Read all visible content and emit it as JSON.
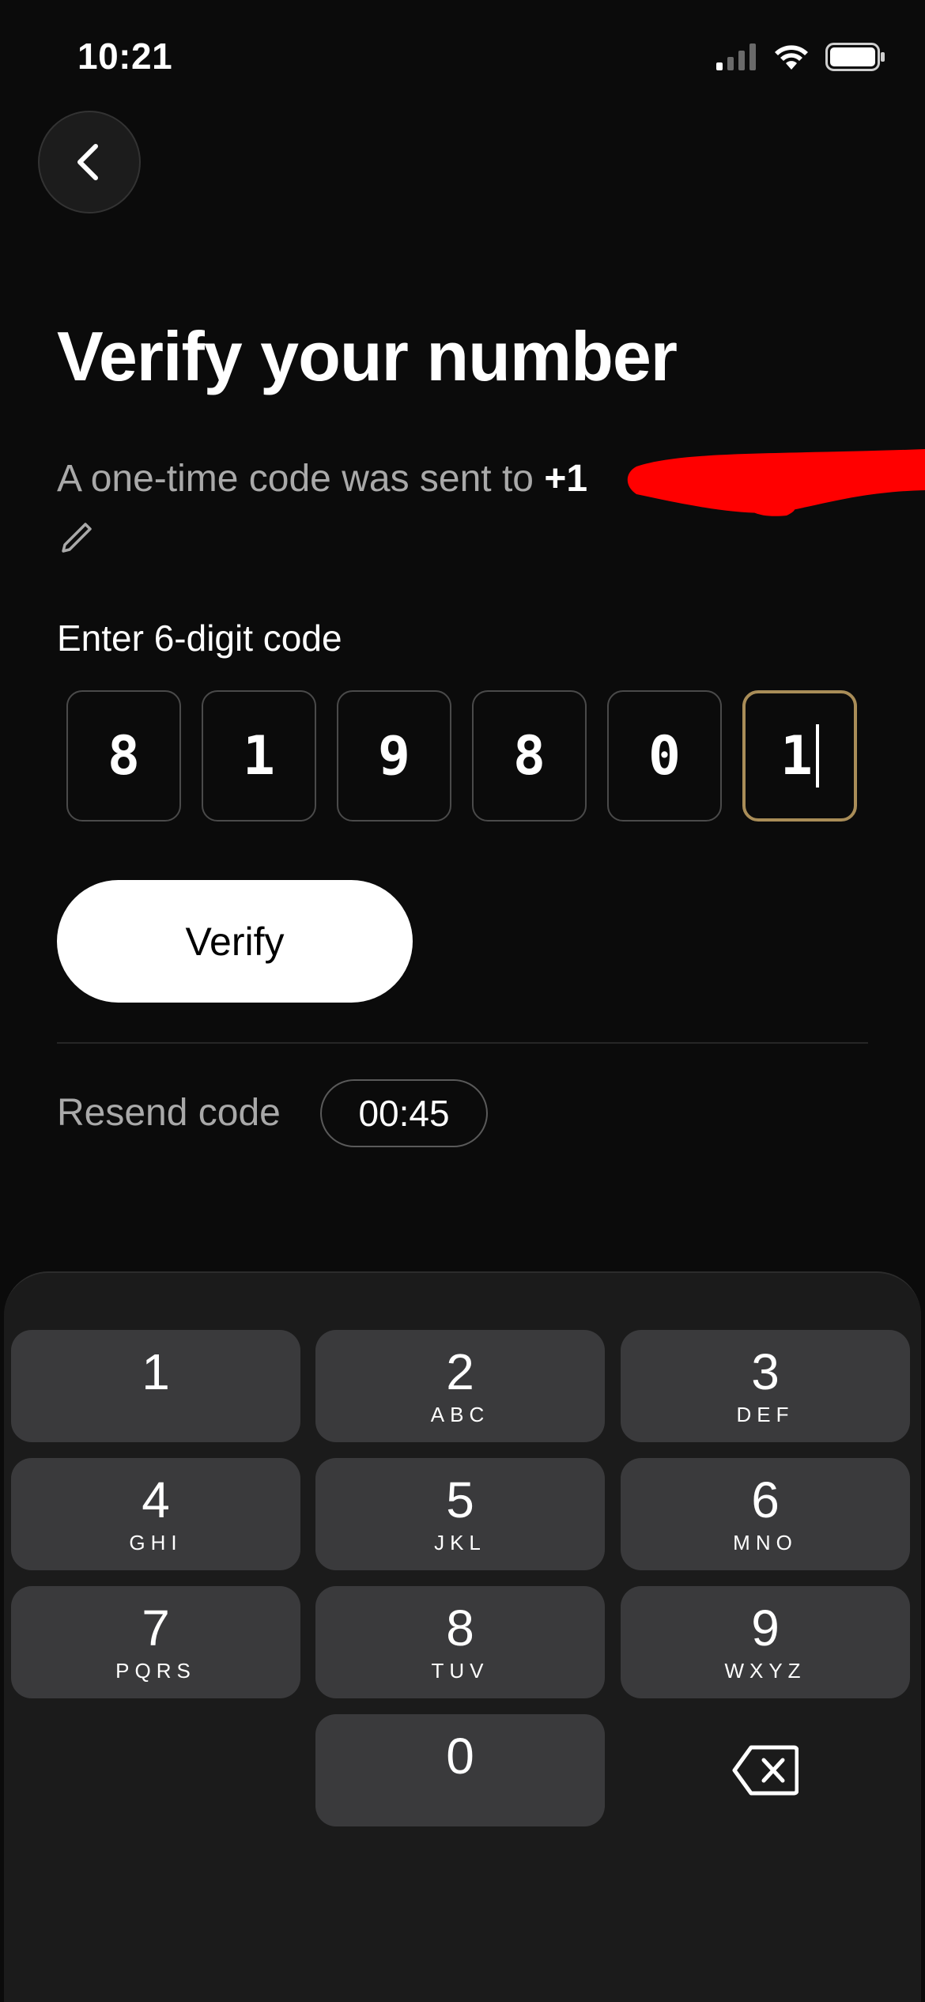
{
  "status_bar": {
    "time": "10:21"
  },
  "header": {
    "title": "Verify your number"
  },
  "subtitle": {
    "text": "A one-time code was sent to ",
    "phone_prefix": "+1"
  },
  "code_entry": {
    "label": "Enter 6-digit code",
    "digits": [
      "8",
      "1",
      "9",
      "8",
      "0",
      "1"
    ],
    "active_index": 5
  },
  "actions": {
    "verify_label": "Verify"
  },
  "resend": {
    "label": "Resend code",
    "timer": "00:45"
  },
  "keypad": {
    "keys": [
      {
        "digit": "1",
        "letters": ""
      },
      {
        "digit": "2",
        "letters": "ABC"
      },
      {
        "digit": "3",
        "letters": "DEF"
      },
      {
        "digit": "4",
        "letters": "GHI"
      },
      {
        "digit": "5",
        "letters": "JKL"
      },
      {
        "digit": "6",
        "letters": "MNO"
      },
      {
        "digit": "7",
        "letters": "PQRS"
      },
      {
        "digit": "8",
        "letters": "TUV"
      },
      {
        "digit": "9",
        "letters": "WXYZ"
      },
      {
        "digit": "0",
        "letters": ""
      }
    ]
  },
  "colors": {
    "background": "#0b0b0b",
    "active_border": "#a98d58",
    "key_background": "#3a3a3c",
    "keypad_background": "#1b1b1b",
    "redaction": "#ff0000"
  },
  "icons": [
    "back-chevron-icon",
    "signal-icon",
    "wifi-icon",
    "battery-icon",
    "pencil-icon",
    "backspace-icon"
  ]
}
